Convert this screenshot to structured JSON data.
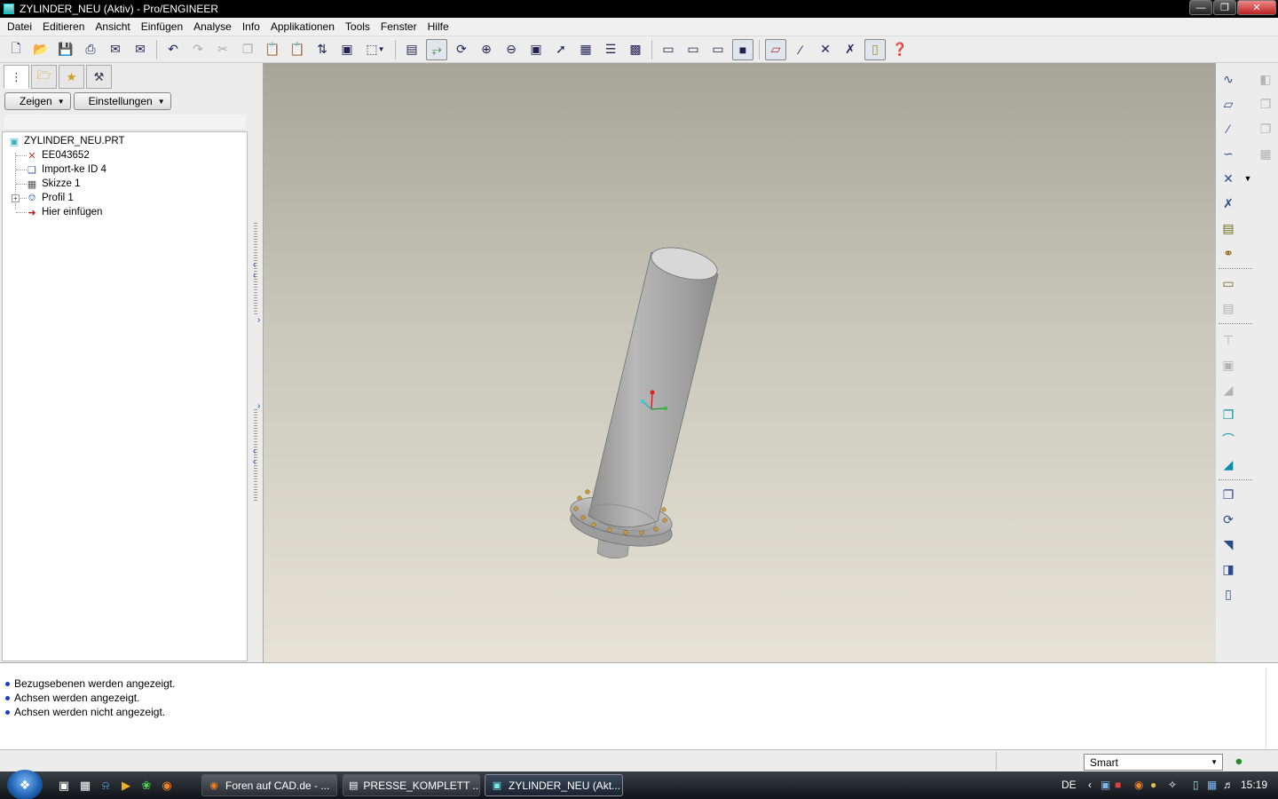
{
  "window": {
    "title": "ZYLINDER_NEU (Aktiv) - Pro/ENGINEER"
  },
  "menu": [
    "Datei",
    "Editieren",
    "Ansicht",
    "Einfügen",
    "Analyse",
    "Info",
    "Applikationen",
    "Tools",
    "Fenster",
    "Hilfe"
  ],
  "left_panel": {
    "buttons": {
      "show": "Zeigen",
      "settings": "Einstellungen"
    },
    "tree": {
      "root": "ZYLINDER_NEU.PRT",
      "items": [
        "EE043652",
        "Import-ke ID 4",
        "Skizze 1",
        "Profil 1",
        "Hier einfügen"
      ]
    }
  },
  "messages": [
    "Bezugsebenen werden angezeigt.",
    "Achsen werden angezeigt.",
    "Achsen werden nicht angezeigt."
  ],
  "status": {
    "selection_filter": "Smart"
  },
  "taskbar": {
    "tasks": [
      "Foren auf CAD.de - ...",
      "PRESSE_KOMPLETT ...",
      "ZYLINDER_NEU (Akt..."
    ],
    "language": "DE",
    "clock": "15:19"
  },
  "colors": {
    "graphics_bg_top": "#a7a597",
    "graphics_bg_bottom": "#e6e3d6",
    "model_gray": "#b4b4b4",
    "bolt_color": "#c89a3a",
    "message_bullet": "#1a3cc8"
  },
  "icons": {
    "toolbar": [
      "new-file-icon",
      "open-icon",
      "save-icon",
      "print-icon",
      "email-icon",
      "email-link-icon",
      "undo-icon",
      "redo-icon",
      "cut-icon",
      "copy-icon",
      "paste-icon",
      "paste-special-icon",
      "regenerate-icon",
      "find-icon",
      "select-box-icon",
      "redraw-icon",
      "spin-center-icon",
      "orient-icon",
      "zoom-in-icon",
      "zoom-out-icon",
      "refit-icon",
      "reorient-icon",
      "saved-views-icon",
      "layers-icon",
      "view-manager-icon",
      "wireframe-icon",
      "hidden-line-icon",
      "no-hidden-icon",
      "shading-icon",
      "datum-planes-icon",
      "datum-axes-icon",
      "datum-points-icon",
      "coordinate-systems-icon",
      "annotations-icon",
      "context-help-icon"
    ],
    "right_toolbar": [
      "sketched-datum-curve-icon",
      "datum-plane-icon",
      "datum-axis-icon",
      "datum-curve-icon",
      "datum-point-icon",
      "datum-csys-icon",
      "analysis-feature-icon",
      "sketch-tool-icon",
      "extrude-icon",
      "revolve-icon",
      "sweep-icon",
      "blend-icon",
      "hole-icon",
      "shell-icon",
      "rib-icon",
      "draft-icon",
      "round-icon",
      "chamfer-icon",
      "mirror-icon",
      "merge-icon",
      "trim-icon",
      "pattern-icon",
      "thicken-icon",
      "solidify-icon",
      "offset-icon",
      "intersect-icon"
    ]
  }
}
